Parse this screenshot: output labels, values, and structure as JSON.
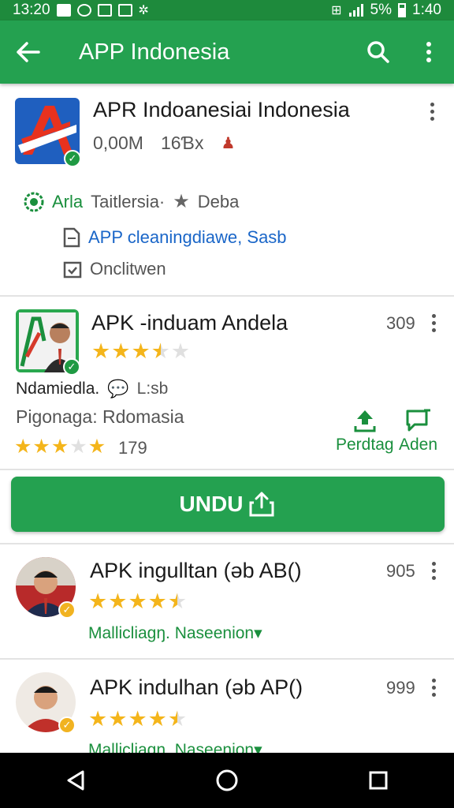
{
  "status_bar": {
    "time": "13:20",
    "battery": "5%",
    "clock_right": "1:40",
    "icons_left": [
      "mail-icon",
      "sync-icon",
      "screenshot-icon",
      "gallery-icon",
      "bug-icon"
    ],
    "icons_right": [
      "vibrate-icon",
      "signal-icon",
      "battery-icon"
    ]
  },
  "app_bar": {
    "title": "APP Indonesia"
  },
  "featured": {
    "name": "APR Indoanesiai Indonesia",
    "size": "0,00M",
    "downloads": "16Ɓx",
    "tag_primary": "Arla",
    "tag_secondary": "Taitlersia·",
    "tag_rating": "Deba",
    "link_text": "APP cleaningdiawe, Sasb",
    "online_text": "Onclitwen"
  },
  "item1": {
    "name": "APK -induam Andela",
    "count": "309",
    "rating": 3.5,
    "developer": "Ndamiedla.",
    "chat_text": "L:sb",
    "category": "Pigonaga: Rdomasia",
    "rating2": 4,
    "reviews": "179",
    "action1": "Perdtag",
    "action2": "Aden"
  },
  "download_button": {
    "label": "UNDU"
  },
  "item2": {
    "name": "APK ingulltan (ǝb AB()",
    "count": "905",
    "rating": 4.5,
    "subtitle": "Mallicliagŋ. Naseenion▾"
  },
  "item3": {
    "name": "APK indulhan (ǝb AP()",
    "count": "999",
    "rating": 4.5,
    "subtitle": "Mallicliagŋ. Naseenion▾"
  },
  "colors": {
    "brand_green": "#24a150",
    "status_green": "#1e8a3c",
    "star_gold": "#f4b51b",
    "link_blue": "#1a66c8"
  }
}
